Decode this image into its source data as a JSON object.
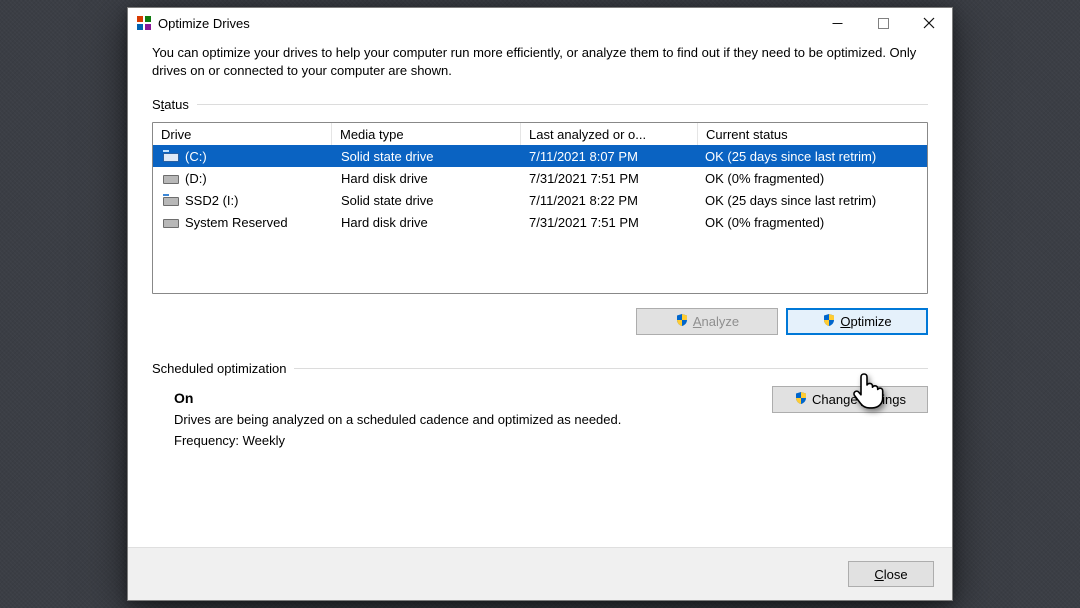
{
  "window": {
    "title": "Optimize Drives"
  },
  "description": "You can optimize your drives to help your computer run more efficiently, or analyze them to find out if they need to be optimized. Only drives on or connected to your computer are shown.",
  "status_label_pre": "S",
  "status_label_ul": "t",
  "status_label_post": "atus",
  "columns": {
    "drive": "Drive",
    "media": "Media type",
    "last": "Last analyzed or o...",
    "status": "Current status"
  },
  "drives": [
    {
      "name": "(C:)",
      "media": "Solid state drive",
      "last": "7/11/2021 8:07 PM",
      "status": "OK (25 days since last retrim)",
      "ssd": true,
      "selected": true
    },
    {
      "name": "(D:)",
      "media": "Hard disk drive",
      "last": "7/31/2021 7:51 PM",
      "status": "OK (0% fragmented)",
      "ssd": false,
      "selected": false
    },
    {
      "name": "SSD2 (I:)",
      "media": "Solid state drive",
      "last": "7/11/2021 8:22 PM",
      "status": "OK (25 days since last retrim)",
      "ssd": true,
      "selected": false
    },
    {
      "name": "System Reserved",
      "media": "Hard disk drive",
      "last": "7/31/2021 7:51 PM",
      "status": "OK (0% fragmented)",
      "ssd": false,
      "selected": false
    }
  ],
  "buttons": {
    "analyze_ul": "A",
    "analyze_post": "nalyze",
    "optimize_ul": "O",
    "optimize_post": "ptimize",
    "change_pre": "Change ",
    "change_ul": "s",
    "change_post": "ettings",
    "close_ul": "C",
    "close_post": "lose"
  },
  "scheduled": {
    "heading": "Scheduled optimization",
    "state": "On",
    "line1": "Drives are being analyzed on a scheduled cadence and optimized as needed.",
    "line2": "Frequency: Weekly"
  }
}
